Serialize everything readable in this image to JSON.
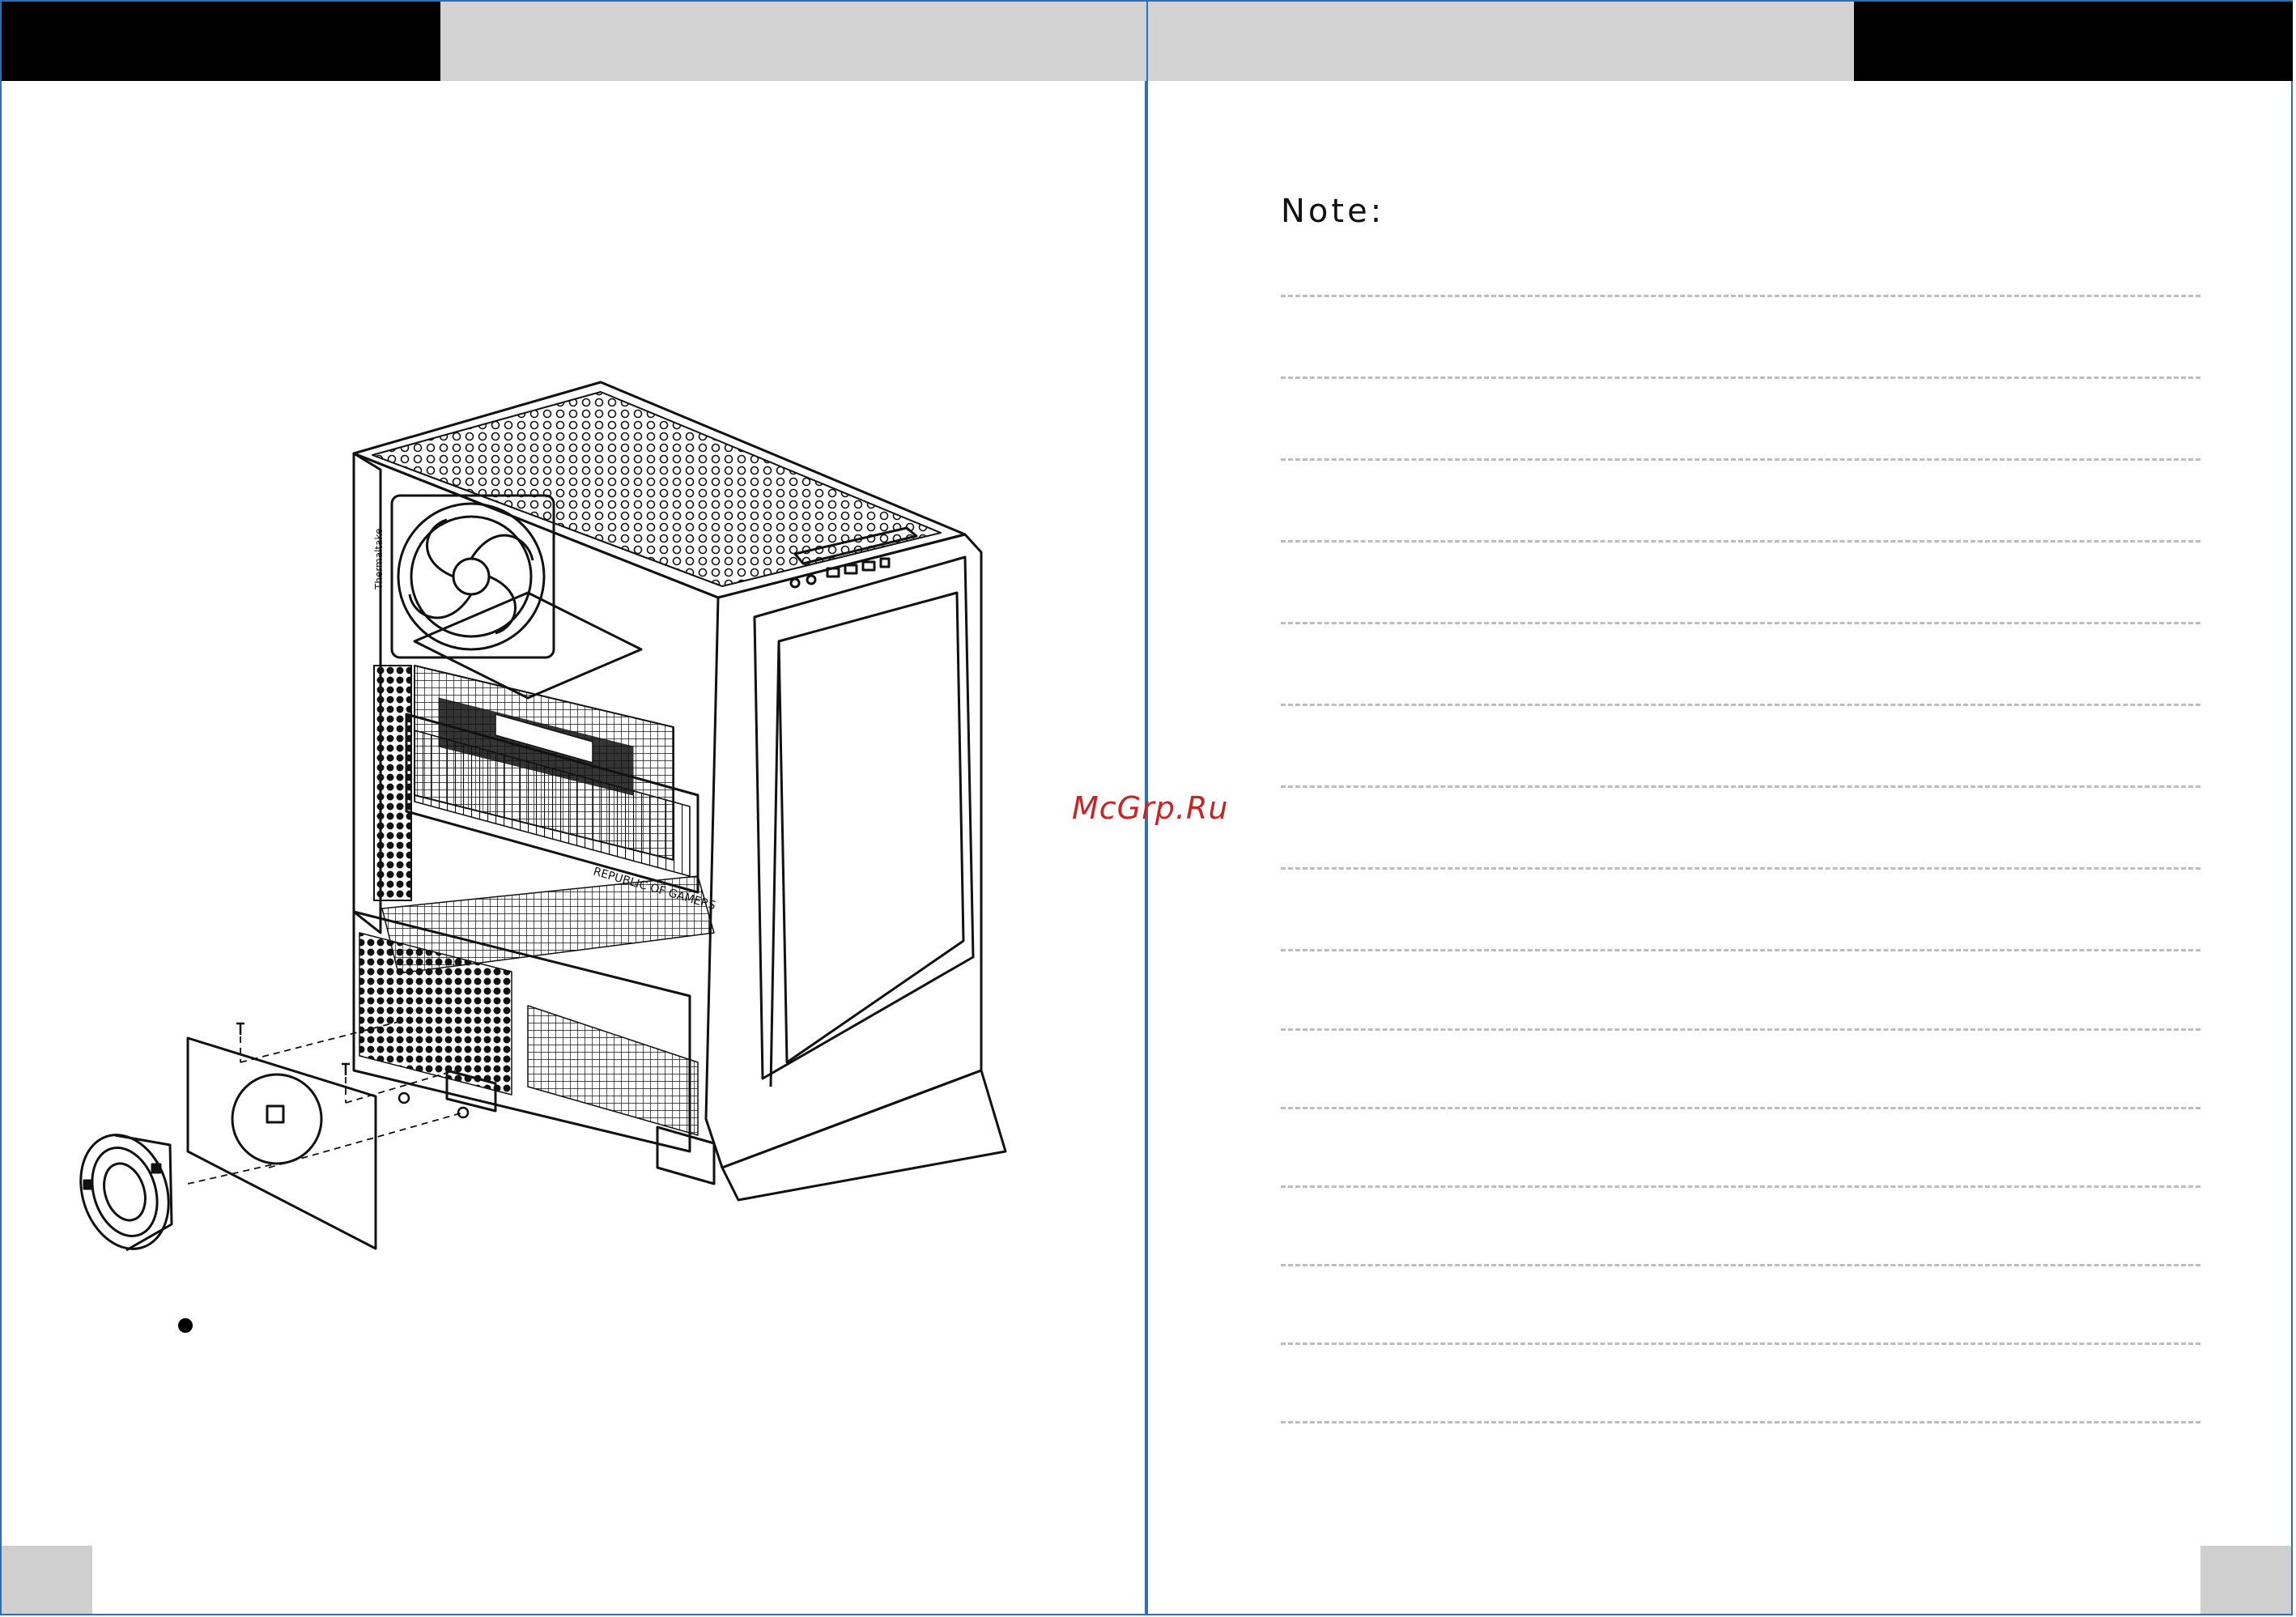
{
  "right_page": {
    "note_label": "Note:"
  },
  "watermark": {
    "text": "McGrp.Ru",
    "color": "#cc2222"
  },
  "colors": {
    "page_border": "#2b6fb8",
    "header_black": "#000000",
    "header_grey": "#d2d2d2",
    "note_line": "#bdbdbd"
  },
  "left_page": {
    "illustration": "pc-case-exploded-view-icon"
  }
}
